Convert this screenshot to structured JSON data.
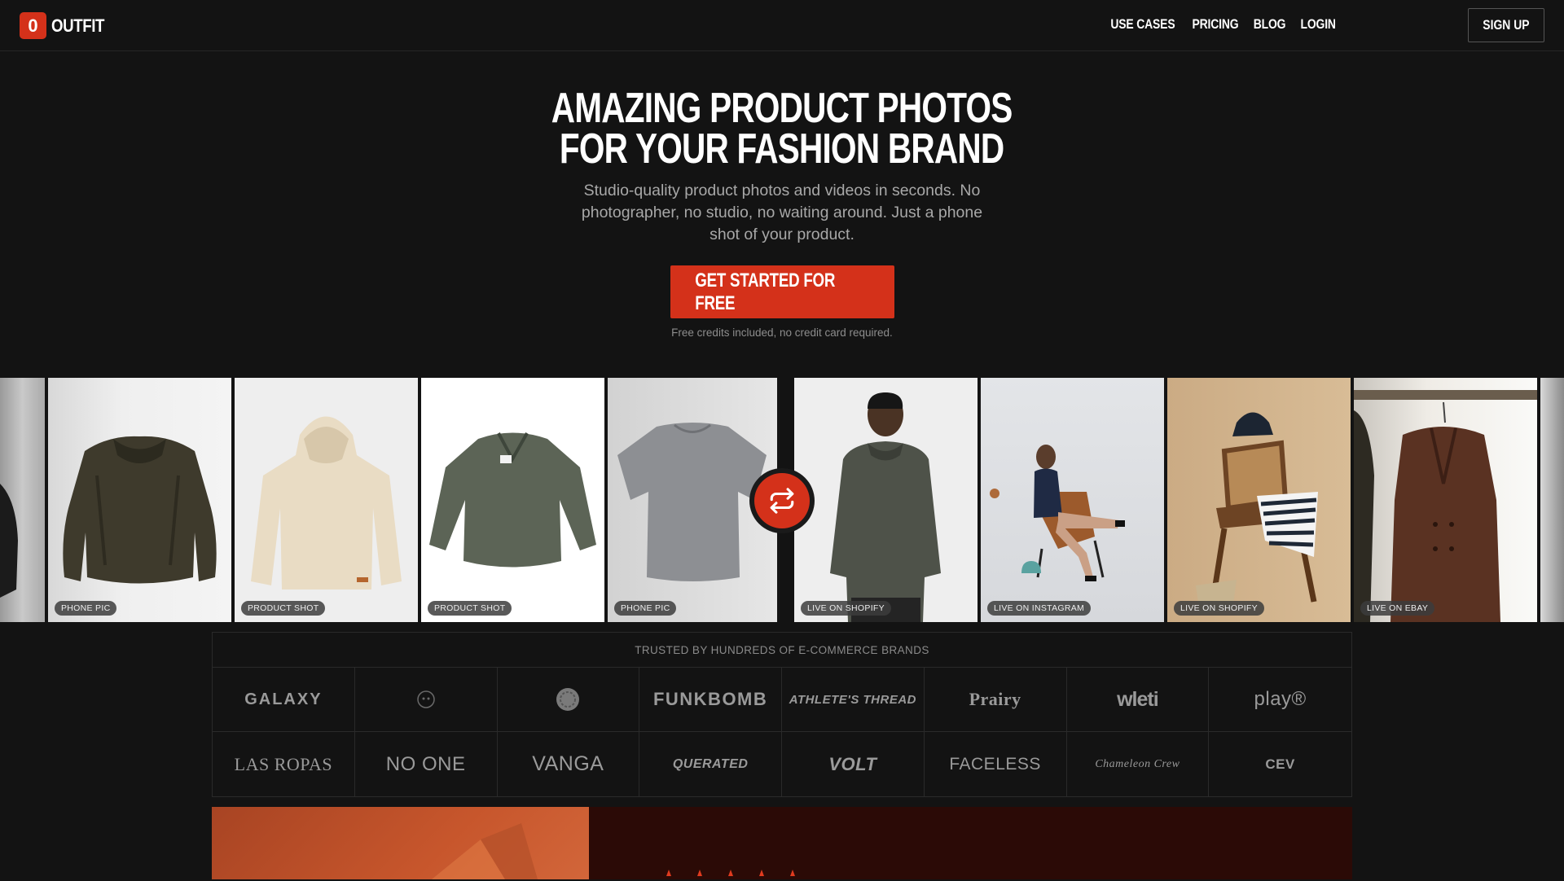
{
  "nav": {
    "logo_letter": "0",
    "logo_text": "OUTFIT",
    "links": [
      "USE CASES",
      "PRICING",
      "BLOG",
      "LOGIN"
    ],
    "signup": "SIGN UP"
  },
  "hero": {
    "title_line1": "AMAZING PRODUCT PHOTOS",
    "title_line2": "FOR YOUR FASHION BRAND",
    "subtitle": "Studio-quality product photos and videos in seconds. No photographer, no studio, no waiting around. Just a phone shot of your product.",
    "cta": "GET STARTED FOR FREE",
    "cta_note": "Free credits included, no credit card required."
  },
  "gallery": {
    "tiles": [
      {
        "label": "",
        "name": "partial-left"
      },
      {
        "label": "PHONE PIC",
        "name": "fur-jacket"
      },
      {
        "label": "PRODUCT SHOT",
        "name": "cream-hoodie"
      },
      {
        "label": "PRODUCT SHOT",
        "name": "green-quarter-zip"
      },
      {
        "label": "PHONE PIC",
        "name": "grey-tshirt"
      },
      {
        "label": "LIVE ON SHOPIFY",
        "name": "model-hoodie"
      },
      {
        "label": "LIVE ON INSTAGRAM",
        "name": "model-chair"
      },
      {
        "label": "LIVE ON SHOPIFY",
        "name": "chair-styled"
      },
      {
        "label": "LIVE ON EBAY",
        "name": "brown-coat"
      }
    ]
  },
  "brands": {
    "title": "TRUSTED BY HUNDREDS OF E-COMMERCE BRANDS",
    "row1": [
      "GALAXY",
      "",
      "",
      "FUNKBOMB",
      "ATHLETE'S THREAD",
      "Prairy",
      "wleti",
      "play®"
    ],
    "row2": [
      "LAS ROPAS",
      "NO ONE",
      "VANGA",
      "QUERATED",
      "VOLT",
      "FACELESS",
      "Chameleon Crew",
      "CEV"
    ]
  },
  "colors": {
    "accent": "#d4311a",
    "background": "#131313"
  }
}
